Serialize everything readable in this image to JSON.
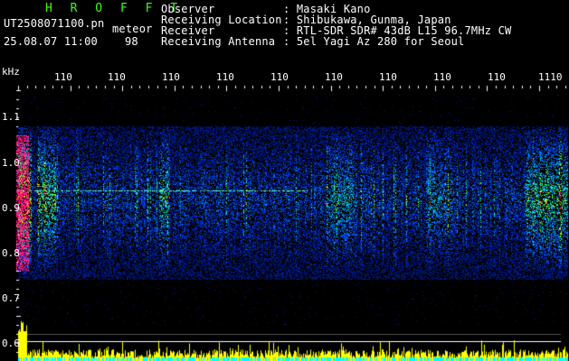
{
  "header": {
    "app_name": "H R O F F T",
    "filename": "UT2508071100.pn",
    "mode": "meteor",
    "datetime": "25.08.07 11:00",
    "count": "98",
    "fields": [
      {
        "label": "Observer",
        "value": ": Masaki Kano"
      },
      {
        "label": "Receiving Location",
        "value": ": Shibukawa, Gunma, Japan"
      },
      {
        "label": "Receiver",
        "value": ": RTL-SDR SDR# 43dB L15 96.7MHz CW"
      },
      {
        "label": "Receiving Antenna",
        "value": ": 5el Yagi Az 280 for Seoul"
      }
    ]
  },
  "axes": {
    "y_unit": "kHz",
    "y_ticks": [
      "1.1",
      "1.0",
      "0.9",
      "0.8",
      "0.7",
      "0.6"
    ],
    "x_ticks": [
      "110",
      "110",
      "110",
      "110",
      "110",
      "110",
      "110",
      "110",
      "110",
      "1110"
    ]
  },
  "colors": {
    "background": "#000000",
    "header_green": "#39ff14",
    "signal_yellow": "#ffff00",
    "signal_cyan": "#00ffff"
  }
}
